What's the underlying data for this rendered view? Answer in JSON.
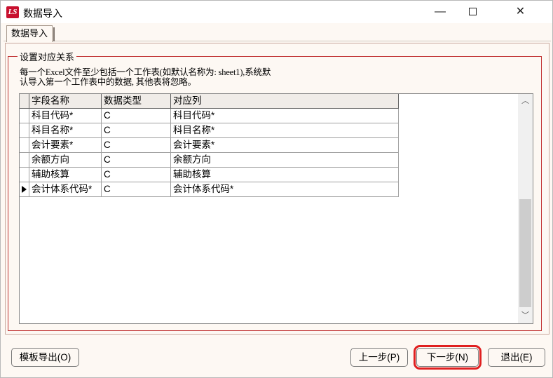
{
  "window": {
    "icon_text": "LS",
    "title": "数据导入",
    "minimize": "—",
    "close": "✕"
  },
  "tabs": [
    {
      "label": "数据导入"
    }
  ],
  "group": {
    "legend": "设置对应关系",
    "note_line1": "每一个Excel文件至少包括一个工作表(如默认名称为: sheet1),系统默",
    "note_line2": "认导入第一个工作表中的数据, 其他表将忽略。"
  },
  "grid": {
    "columns": [
      "字段名称",
      "数据类型",
      "对应列"
    ],
    "rows": [
      {
        "field": "科目代码*",
        "type": "C",
        "mapped": "科目代码*",
        "current": false
      },
      {
        "field": "科目名称*",
        "type": "C",
        "mapped": "科目名称*",
        "current": false
      },
      {
        "field": "会计要素*",
        "type": "C",
        "mapped": "会计要素*",
        "current": false
      },
      {
        "field": "余额方向",
        "type": "C",
        "mapped": "余额方向",
        "current": false
      },
      {
        "field": "辅助核算",
        "type": "C",
        "mapped": "辅助核算",
        "current": false
      },
      {
        "field": "会计体系代码*",
        "type": "C",
        "mapped": "会计体系代码*",
        "current": true
      }
    ]
  },
  "buttons": {
    "template_export": "模板导出(O)",
    "prev": "上一步(P)",
    "next": "下一步(N)",
    "exit": "退出(E)"
  },
  "colors": {
    "highlight": "#e02020",
    "group_border": "#c03030",
    "app_icon": "#c8102e"
  }
}
